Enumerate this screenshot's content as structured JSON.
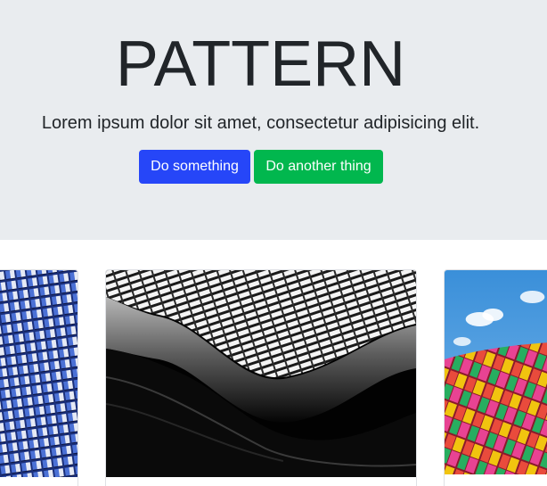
{
  "hero": {
    "title": "PATTERN",
    "lead": "Lorem ipsum dolor sit amet, consectetur adipisicing elit.",
    "primary_button": "Do something",
    "secondary_button": "Do another thing"
  },
  "colors": {
    "hero_background": "#e9ecef",
    "primary": "#2646f8",
    "success": "#01b74e",
    "text": "#212529"
  },
  "cards": [
    {
      "image": "blue-glass-building-facade-photo"
    },
    {
      "image": "black-and-white-wave-architecture-photo"
    },
    {
      "image": "colorful-tiled-building-facade-photo"
    }
  ]
}
